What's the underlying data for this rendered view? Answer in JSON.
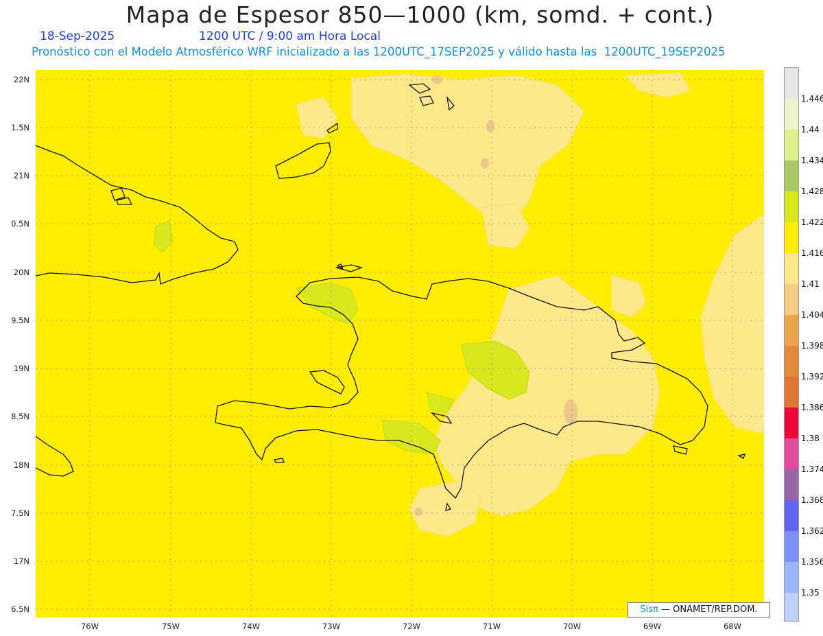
{
  "header": {
    "title": "Mapa de Espesor 850—1000 (km, somd. + cont.)",
    "date": "18-Sep-2025",
    "time": "1200 UTC / 9:00 am Hora Local",
    "description": "Pronóstico con el Modelo Atmosférico WRF inicializado a las 1200UTC_17SEP2025 y válido hasta las  1200UTC_19SEP2025"
  },
  "axes": {
    "latitude_labels": [
      "22N",
      "1.5N",
      "21N",
      "0.5N",
      "20N",
      "9.5N",
      "19N",
      "8.5N",
      "18N",
      "7.5N",
      "17N",
      "6.5N"
    ],
    "longitude_labels": [
      "76W",
      "75W",
      "74W",
      "73W",
      "72W",
      "71W",
      "70W",
      "69W",
      "68W"
    ]
  },
  "colorbar": {
    "labels": [
      "1.446",
      "1.44",
      "1.434",
      "1.428",
      "1.422",
      "1.416",
      "1.41",
      "1.404",
      "1.398",
      "1.392",
      "1.386",
      "1.38",
      "1.374",
      "1.368",
      "1.362",
      "1.356",
      "1.35"
    ],
    "colors_top_to_bottom": [
      "#e6e6e6",
      "#eef5c8",
      "#dcf08c",
      "#a8c864",
      "#d8e81e",
      "#ffee00",
      "#fde88a",
      "#f4cc84",
      "#eca44a",
      "#e4883a",
      "#df7434",
      "#ec0a3a",
      "#e24aa0",
      "#9a66a8",
      "#6464f0",
      "#7a90f8",
      "#9ab6fc",
      "#c0d0fc"
    ]
  },
  "map": {
    "base_color": "#ffee00",
    "high_color": "#fde88a",
    "higher_color": "#ecc88a",
    "green_color": "#d8e81e",
    "coast_color": "#111111",
    "grid_color": "#8a8aa0"
  },
  "credit": {
    "logo": "Sisπ",
    "text": "— ONAMET/REP.DOM."
  }
}
